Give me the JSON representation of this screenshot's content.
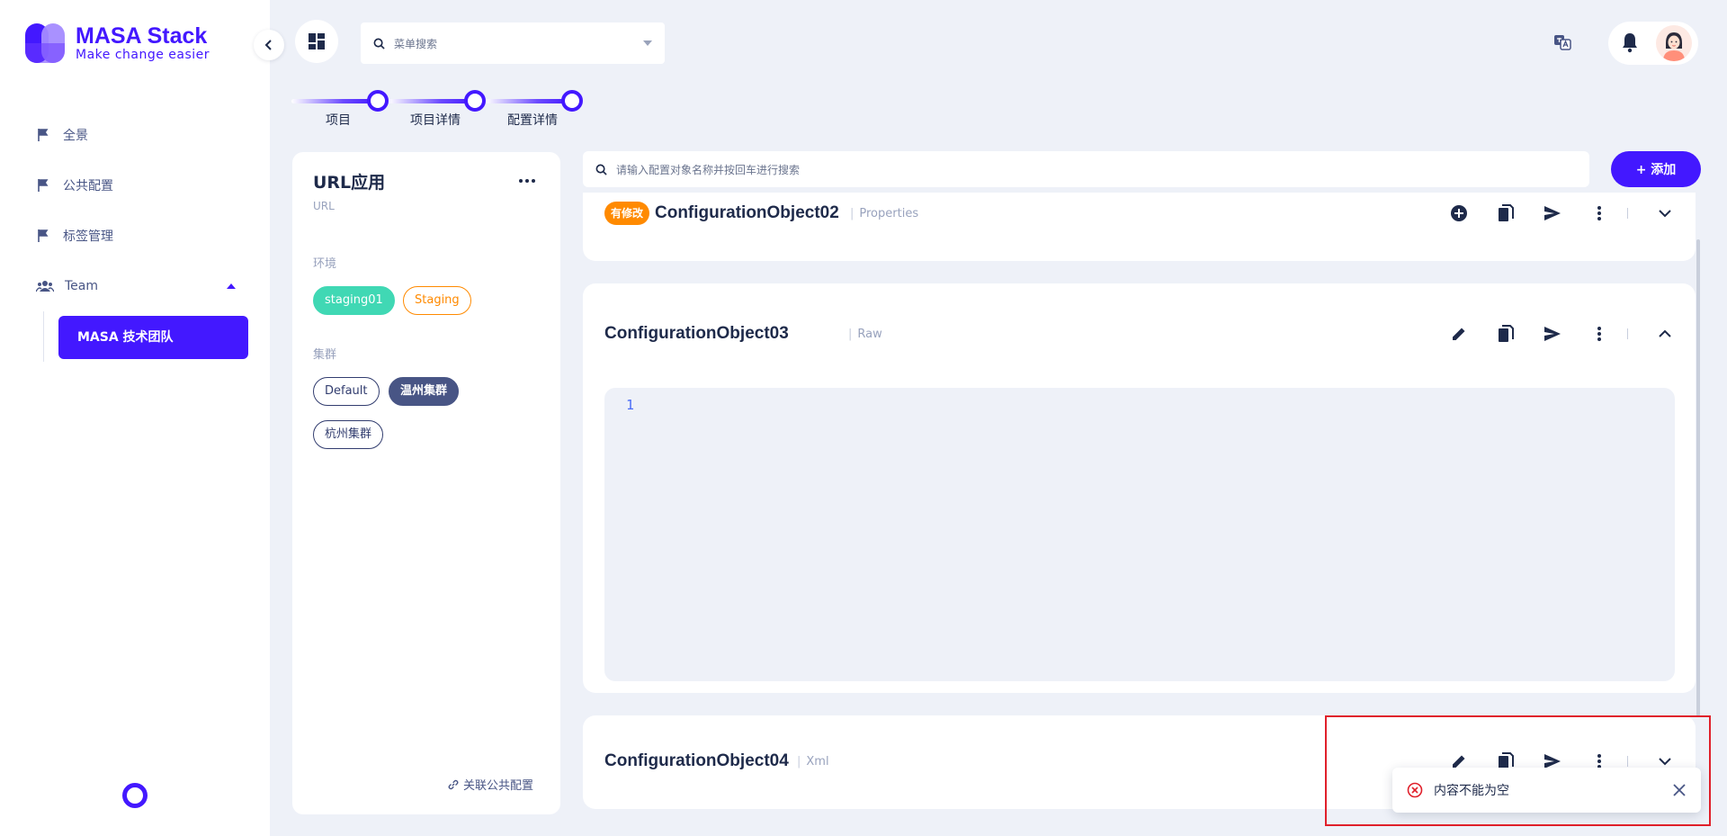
{
  "brand": {
    "title": "MASA Stack",
    "tagline": "Make change easier",
    "color": "#4318ff"
  },
  "sidebar": {
    "items": [
      {
        "label": "全景",
        "icon": "flag-icon"
      },
      {
        "label": "公共配置",
        "icon": "flag-icon"
      },
      {
        "label": "标签管理",
        "icon": "flag-icon"
      },
      {
        "label": "Team",
        "icon": "team-icon"
      }
    ],
    "team_active": "MASA 技术团队"
  },
  "header": {
    "menu_search_placeholder": "菜单搜索"
  },
  "stepper": {
    "steps": [
      "项目",
      "项目详情",
      "配置详情"
    ]
  },
  "app": {
    "title": "URL应用",
    "subtitle": "URL",
    "env_label": "环境",
    "envs": [
      "staging01",
      "Staging"
    ],
    "cluster_label": "集群",
    "clusters": [
      "Default",
      "温州集群",
      "杭州集群"
    ],
    "link_public": "关联公共配置"
  },
  "config_search": {
    "placeholder": "请输入配置对象名称并按回车进行搜索",
    "add_label": "+ 添加"
  },
  "configs": [
    {
      "badge": "有修改",
      "name": "ConfigurationObject02",
      "type": "Properties",
      "expanded": false
    },
    {
      "badge": "",
      "name": "ConfigurationObject03",
      "type": "Raw",
      "expanded": true,
      "line_number": "1"
    },
    {
      "badge": "",
      "name": "ConfigurationObject04",
      "type": "Xml",
      "expanded": false
    }
  ],
  "toast": {
    "message": "内容不能为空",
    "status_color": "#e0202b"
  }
}
